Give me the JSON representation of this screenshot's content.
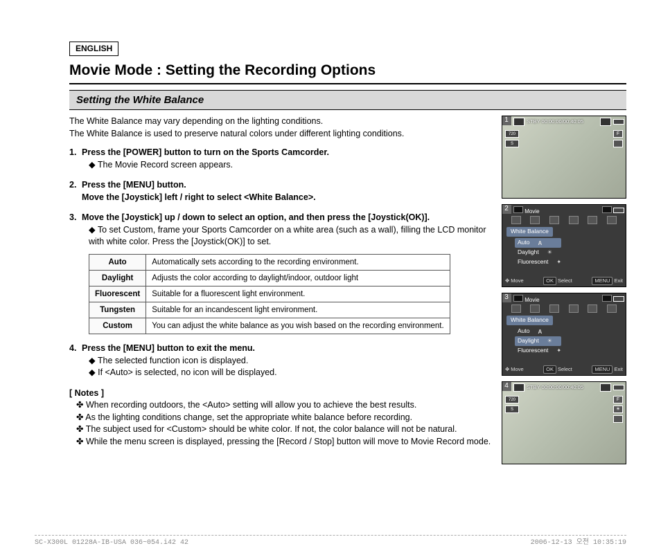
{
  "language_label": "ENGLISH",
  "title": "Movie Mode : Setting the Recording Options",
  "subtitle": "Setting the White Balance",
  "intro": {
    "line1": "The White Balance may vary depending on the lighting conditions.",
    "line2": "The White Balance is used to preserve natural colors under different lighting conditions."
  },
  "steps": {
    "s1": {
      "num": "1.",
      "head": "Press the [POWER] button to turn on the Sports Camcorder.",
      "sub1": "The Movie Record screen appears."
    },
    "s2": {
      "num": "2.",
      "head_line1": "Press the [MENU] button.",
      "head_line2": "Move the [Joystick] left / right to select <White Balance>."
    },
    "s3": {
      "num": "3.",
      "head": "Move the [Joystick] up / down to select an option, and then press the [Joystick(OK)].",
      "sub1": "To set Custom, frame your Sports Camcorder on a white area (such as a wall), filling the LCD monitor with white color. Press the [Joystick(OK)] to set."
    },
    "s4": {
      "num": "4.",
      "head": "Press the [MENU] button to exit the menu.",
      "sub1": "The selected function icon is displayed.",
      "sub2": "If <Auto> is selected, no icon will be displayed."
    }
  },
  "wb_table": {
    "r1": {
      "name": "Auto",
      "desc": "Automatically sets according to the recording environment."
    },
    "r2": {
      "name": "Daylight",
      "desc": "Adjusts the color according to daylight/indoor, outdoor light"
    },
    "r3": {
      "name": "Fluorescent",
      "desc": "Suitable for a fluorescent light environment."
    },
    "r4": {
      "name": "Tungsten",
      "desc": "Suitable for an incandescent light environment."
    },
    "r5": {
      "name": "Custom",
      "desc": "You can adjust the white balance as you wish based on the recording environment."
    }
  },
  "notes_head": "[ Notes ]",
  "notes": {
    "n1": "When recording outdoors, the <Auto> setting will allow you to achieve the best results.",
    "n2": "As the lighting conditions change, set the appropriate white balance before recording.",
    "n3": "The subject used for <Custom> should be white color. If not, the color balance will not be natural.",
    "n4": "While the menu screen is displayed, pressing the [Record / Stop] button will move to Movie Record mode."
  },
  "page_number": "42",
  "foot": {
    "left": "SC-X300L 01228A-IB-USA 036~054.i42   42",
    "right": "2006-12-13   오전 10:35:19"
  },
  "screens": {
    "s1": {
      "idx": "1",
      "stby": "STBY 00:00:00/00:40:05",
      "resolution": "720",
      "indicator": "S",
      "quality": "F"
    },
    "s2": {
      "idx": "2",
      "mode": "Movie",
      "section": "White Balance",
      "opt1": "Auto",
      "opt2": "Daylight",
      "opt3": "Fluorescent",
      "move": "Move",
      "select": "Select",
      "exit": "Exit",
      "ok_label": "OK",
      "menu_label": "MENU"
    },
    "s3": {
      "idx": "3",
      "mode": "Movie",
      "section": "White Balance",
      "opt1": "Auto",
      "opt2": "Daylight",
      "opt3": "Fluorescent",
      "move": "Move",
      "select": "Select",
      "exit": "Exit",
      "ok_label": "OK",
      "menu_label": "MENU"
    },
    "s4": {
      "idx": "4",
      "stby": "STBY 00:00:00/00:40:05",
      "resolution": "720",
      "indicator": "S",
      "quality": "F"
    }
  }
}
